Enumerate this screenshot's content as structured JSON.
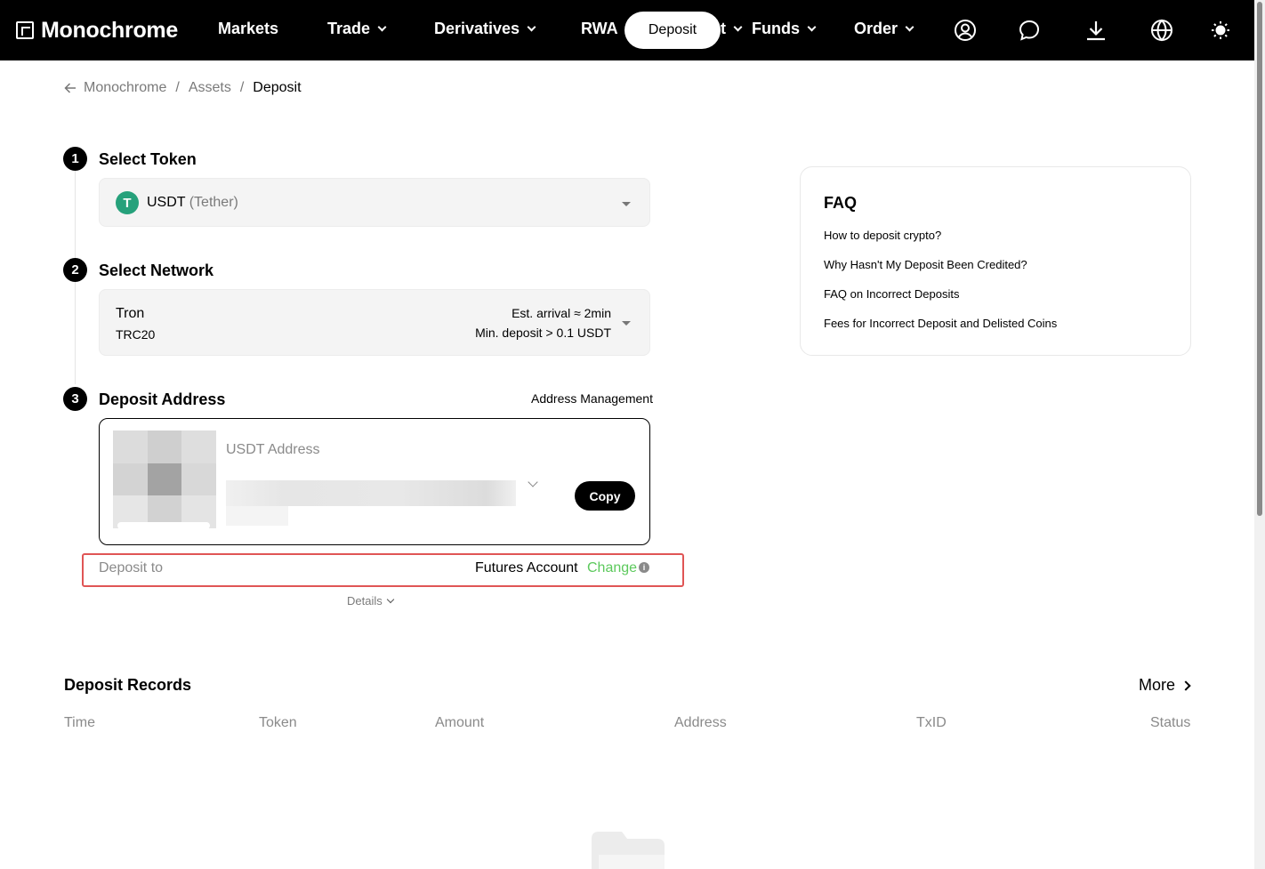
{
  "nav": {
    "brand": "Monochrome",
    "items": [
      {
        "label": "Markets",
        "dropdown": false
      },
      {
        "label": "Trade",
        "dropdown": true
      },
      {
        "label": "Derivatives",
        "dropdown": true
      },
      {
        "label": "RWA",
        "dropdown": false
      },
      {
        "label": "t",
        "dropdown": true
      },
      {
        "label": "Funds",
        "dropdown": true
      },
      {
        "label": "Order",
        "dropdown": true
      }
    ],
    "deposit_button": "Deposit",
    "icons": [
      "user-icon",
      "chat-icon",
      "download-icon",
      "globe-icon",
      "sun-icon"
    ]
  },
  "breadcrumb": {
    "items": [
      "Monochrome",
      "Assets",
      "Deposit"
    ],
    "separator": "/"
  },
  "steps": {
    "token": {
      "number": "1",
      "title": "Select Token",
      "symbol": "USDT",
      "name": "(Tether)",
      "logo_glyph": "T",
      "logo_color": "#26a17b"
    },
    "network": {
      "number": "2",
      "title": "Select Network",
      "name": "Tron",
      "standard": "TRC20",
      "arrival": "Est. arrival ≈ 2min",
      "min_deposit": "Min. deposit > 0.1 USDT"
    },
    "address": {
      "number": "3",
      "title": "Deposit Address",
      "management_link": "Address Management",
      "address_label": "USDT Address",
      "copy_button": "Copy"
    }
  },
  "deposit_to": {
    "label": "Deposit to",
    "value": "Futures Account",
    "change_link": "Change",
    "highlight_color": "#e05555",
    "change_color": "#5cc95c"
  },
  "details_toggle": "Details",
  "faq": {
    "title": "FAQ",
    "items": [
      "How to deposit crypto?",
      "Why Hasn't My Deposit Been Credited?",
      "FAQ on Incorrect Deposits",
      "Fees for Incorrect Deposit and Delisted Coins"
    ]
  },
  "records": {
    "title": "Deposit Records",
    "more_link": "More",
    "columns": [
      "Time",
      "Token",
      "Amount",
      "Address",
      "TxID",
      "Status"
    ]
  }
}
